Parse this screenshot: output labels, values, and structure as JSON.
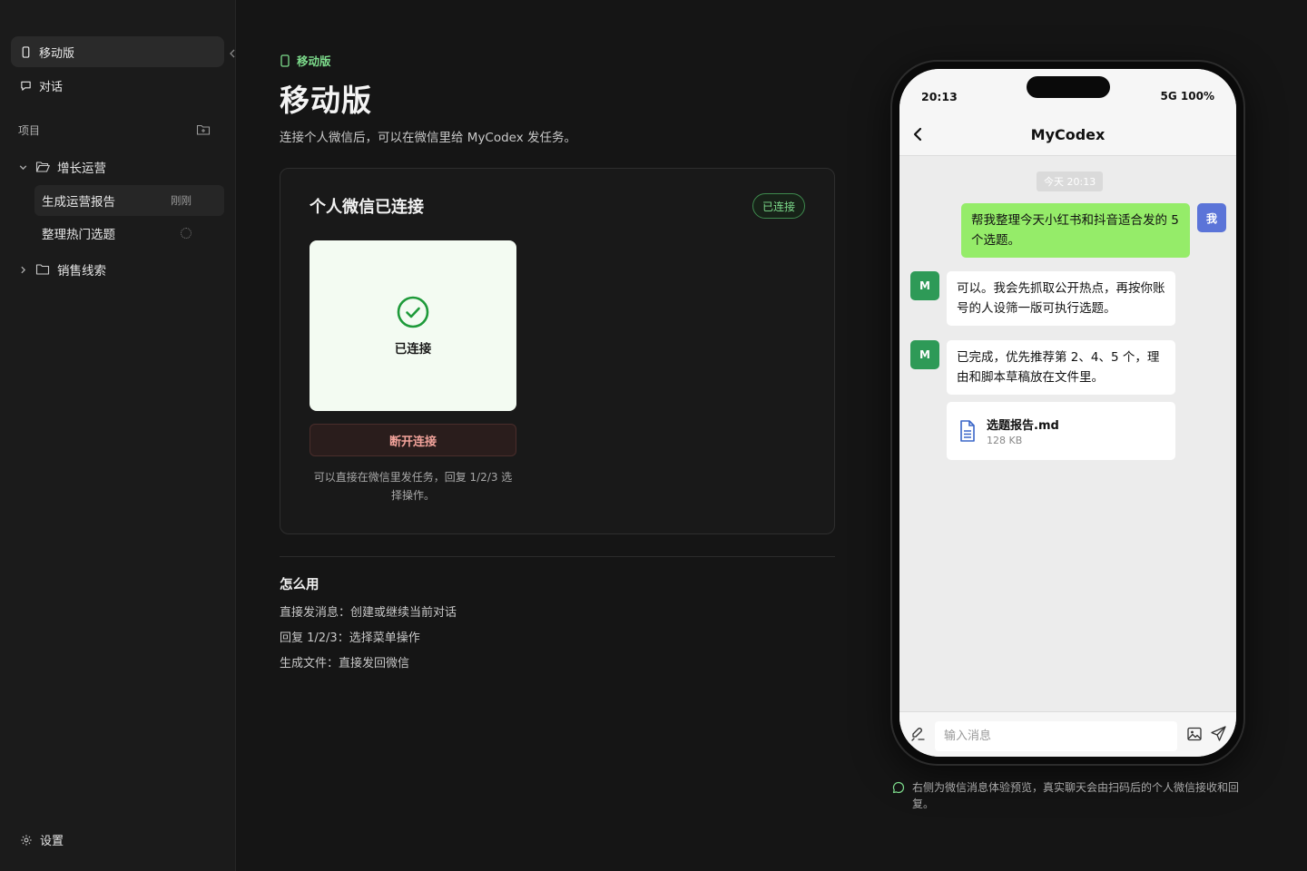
{
  "sidebar": {
    "nav": [
      {
        "label": "移动版",
        "icon": "phone-icon",
        "active": true
      },
      {
        "label": "对话",
        "icon": "chat-bubble-icon",
        "active": false
      }
    ],
    "section_label": "项目",
    "projects": [
      {
        "label": "增长运营",
        "expanded": true,
        "items": [
          {
            "label": "生成运营报告",
            "meta": "刚刚",
            "active": true
          },
          {
            "label": "整理热门选题",
            "status": "loading"
          }
        ]
      },
      {
        "label": "销售线索",
        "expanded": false
      }
    ],
    "settings_label": "设置"
  },
  "main": {
    "breadcrumb": "移动版",
    "title": "移动版",
    "subtitle": "连接个人微信后，可以在微信里给 MyCodex 发任务。",
    "card": {
      "title": "个人微信已连接",
      "badge": "已连接",
      "status_label": "已连接",
      "disconnect_label": "断开连接",
      "hint": "可以直接在微信里发任务，回复 1/2/3 选择操作。"
    },
    "howto": {
      "title": "怎么用",
      "items": [
        "直接发消息：创建或继续当前对话",
        "回复 1/2/3：选择菜单操作",
        "生成文件：直接发回微信"
      ]
    }
  },
  "phone": {
    "time": "20:13",
    "signal": "5G 100%",
    "chat_title": "MyCodex",
    "time_chip": "今天 20:13",
    "messages": [
      {
        "from": "me",
        "avatar": "我",
        "text": "帮我整理今天小红书和抖音适合发的 5 个选题。"
      },
      {
        "from": "bot",
        "avatar": "M",
        "text": "可以。我会先抓取公开热点，再按你账号的人设筛一版可执行选题。"
      },
      {
        "from": "bot",
        "avatar": "M",
        "text": "已完成，优先推荐第 2、4、5 个，理由和脚本草稿放在文件里。"
      }
    ],
    "file": {
      "name": "选题报告.md",
      "size": "128 KB"
    },
    "input_placeholder": "输入消息"
  },
  "preview_note": "右侧为微信消息体验预览，真实聊天会由扫码后的个人微信接收和回复。",
  "colors": {
    "accent_green": "#7ddc8c",
    "wechat_bubble": "#95ec69",
    "danger": "#f1a29a"
  }
}
